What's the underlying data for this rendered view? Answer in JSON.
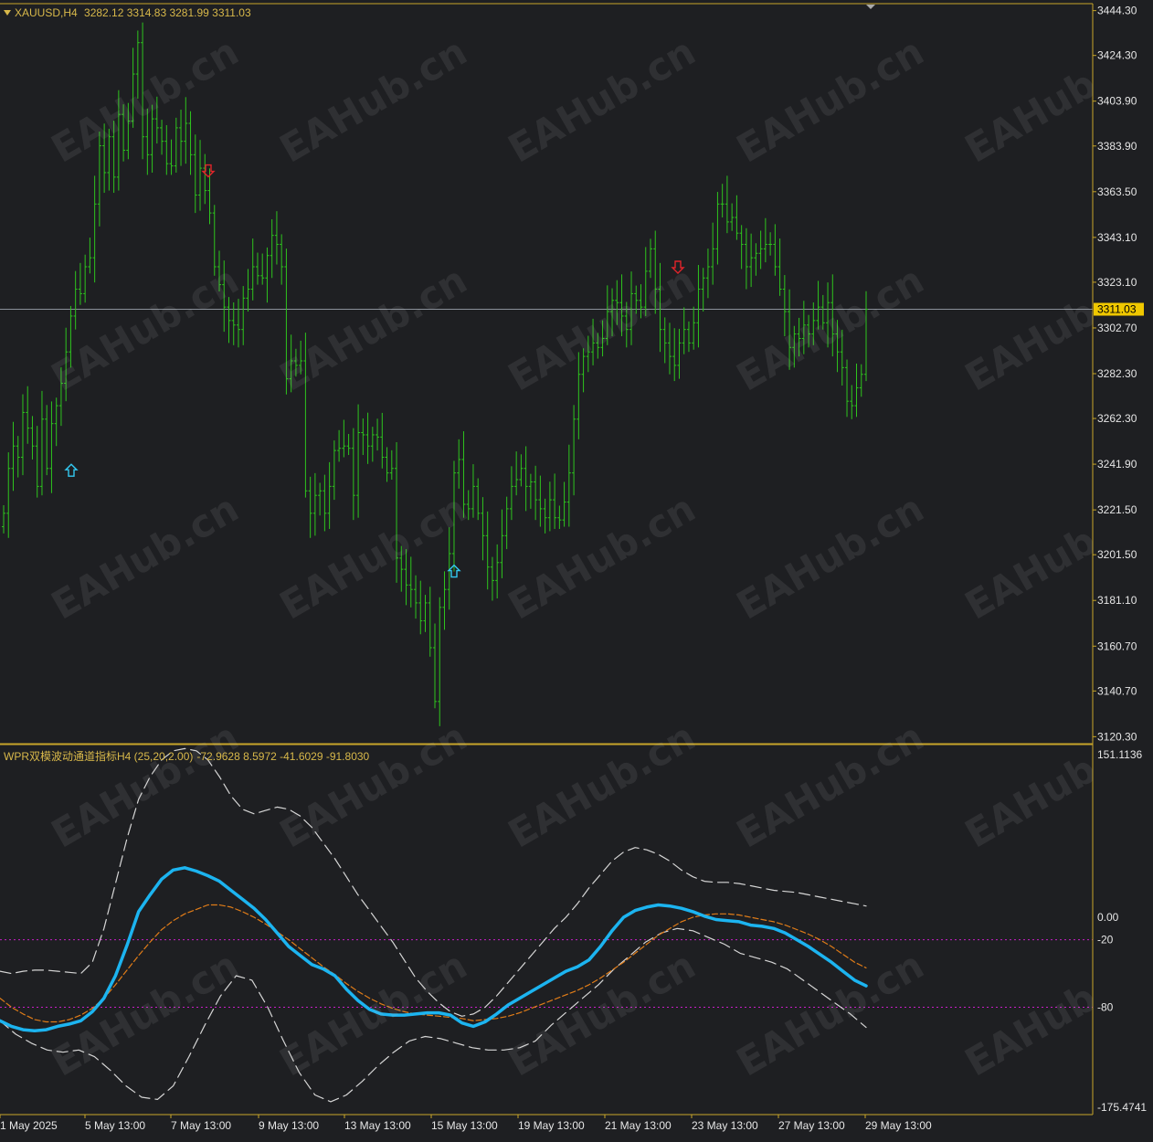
{
  "header": {
    "symbol": "XAUUSD,H4",
    "ohlc": "3282.12 3314.83 3281.99 3311.03"
  },
  "indicator": {
    "title": "WPR双模波动通道指标H4 (25,20,2.00)",
    "values": "-72.9628 8.5972 -41.6029 -91.8030",
    "levels": [
      -20,
      -80
    ],
    "top_label": "151.1136",
    "bottom_label": "-175.4741"
  },
  "watermark": "EAHub.cn",
  "colors": {
    "background": "#1e1f22",
    "frame": "#c8a62a",
    "bar": "#2ec41e",
    "price_line": "#8a9099",
    "price_tag": "#f0c800",
    "arrow_up": "#33c8f0",
    "arrow_down": "#e0242a",
    "wpr_main": "#1cb4f0",
    "wpr_signal": "#e07c18",
    "band": "#d6d6d6",
    "level": "#c81ec8",
    "axis_text": "#e6e6e6"
  },
  "chart_data": {
    "type": "ohlc",
    "price_ticks": [
      "3444.30",
      "3424.30",
      "3403.90",
      "3383.90",
      "3363.50",
      "3343.10",
      "3323.10",
      "3302.70",
      "3282.30",
      "3262.30",
      "3241.90",
      "3221.50",
      "3201.50",
      "3181.10",
      "3160.70",
      "3140.70",
      "3120.30"
    ],
    "current_price": "3311.03",
    "indicator_ticks": [
      "0.00",
      "-20",
      "-80"
    ],
    "time_labels": [
      "1 May 2025",
      "5 May 13:00",
      "7 May 13:00",
      "9 May 13:00",
      "13 May 13:00",
      "15 May 13:00",
      "19 May 13:00",
      "21 May 13:00",
      "23 May 13:00",
      "27 May 13:00",
      "29 May 13:00"
    ],
    "price_ylim": [
      3118,
      3447
    ],
    "wpr_ylim": [
      -175.4741,
      151.1136
    ],
    "price_series": [
      3220,
      3240,
      3250,
      3245,
      3265,
      3258,
      3250,
      3232,
      3262,
      3240,
      3260,
      3268,
      3278,
      3292,
      3308,
      3320,
      3318,
      3330,
      3334,
      3358,
      3384,
      3372,
      3388,
      3370,
      3398,
      3382,
      3395,
      3416,
      3430,
      3388,
      3380,
      3396,
      3392,
      3386,
      3376,
      3375,
      3392,
      3386,
      3394,
      3380,
      3362,
      3374,
      3364,
      3354,
      3330,
      3322,
      3312,
      3306,
      3304,
      3302,
      3316,
      3320,
      3330,
      3326,
      3325,
      3335,
      3344,
      3340,
      3330,
      3280,
      3288,
      3286,
      3288,
      3230,
      3220,
      3228,
      3230,
      3220,
      3232,
      3248,
      3249,
      3250,
      3249,
      3228,
      3256,
      3255,
      3250,
      3255,
      3254,
      3245,
      3238,
      3240,
      3200,
      3195,
      3188,
      3186,
      3180,
      3172,
      3180,
      3160,
      3136,
      3178,
      3186,
      3202,
      3238,
      3244,
      3224,
      3222,
      3232,
      3220,
      3210,
      3196,
      3190,
      3198,
      3210,
      3222,
      3232,
      3235,
      3240,
      3232,
      3234,
      3226,
      3222,
      3218,
      3226,
      3218,
      3217,
      3225,
      3238,
      3262,
      3282,
      3290,
      3292,
      3296,
      3294,
      3298,
      3310,
      3315,
      3314,
      3308,
      3302,
      3318,
      3315,
      3312,
      3328,
      3338,
      3320,
      3302,
      3296,
      3290,
      3286,
      3296,
      3302,
      3296,
      3305,
      3320,
      3325,
      3330,
      3338,
      3358,
      3358,
      3350,
      3352,
      3345,
      3340,
      3330,
      3334,
      3336,
      3338,
      3340,
      3340,
      3330,
      3320,
      3310,
      3294,
      3300,
      3298,
      3304,
      3300,
      3306,
      3312,
      3305,
      3314,
      3300,
      3292,
      3285,
      3270,
      3268,
      3276,
      3282,
      3311
    ],
    "wpr_main": [
      -92,
      -97,
      -100,
      -101,
      -100,
      -97,
      -95,
      -92,
      -84,
      -72,
      -52,
      -25,
      5,
      20,
      34,
      42,
      44,
      41,
      37,
      32,
      24,
      16,
      8,
      -2,
      -14,
      -26,
      -34,
      -42,
      -46,
      -52,
      -64,
      -74,
      -82,
      -86,
      -87,
      -87,
      -86,
      -85,
      -85,
      -87,
      -94,
      -97,
      -93,
      -86,
      -78,
      -72,
      -66,
      -60,
      -54,
      -48,
      -44,
      -38,
      -26,
      -12,
      0,
      6,
      9,
      11,
      10,
      8,
      5,
      1,
      -2,
      -3,
      -4,
      -7,
      -8,
      -10,
      -14,
      -20,
      -26,
      -33,
      -40,
      -48,
      -56,
      -61
    ],
    "wpr_signal": [
      -72,
      -80,
      -86,
      -91,
      -93,
      -93,
      -91,
      -87,
      -81,
      -72,
      -60,
      -47,
      -34,
      -22,
      -11,
      -3,
      3,
      7,
      11,
      11,
      9,
      5,
      0,
      -6,
      -13,
      -20,
      -28,
      -36,
      -44,
      -51,
      -59,
      -66,
      -72,
      -77,
      -81,
      -84,
      -86,
      -87,
      -88,
      -89,
      -90,
      -92,
      -91,
      -90,
      -88,
      -85,
      -81,
      -77,
      -73,
      -69,
      -65,
      -60,
      -54,
      -47,
      -40,
      -32,
      -24,
      -16,
      -10,
      -4,
      0,
      2,
      3,
      3,
      2,
      0,
      -2,
      -4,
      -7,
      -11,
      -15,
      -20,
      -26,
      -33,
      -40,
      -45
    ],
    "wpr_upper": [
      -48,
      -50,
      -48,
      -47,
      -47,
      -48,
      -49,
      -50,
      -40,
      -10,
      30,
      70,
      105,
      125,
      140,
      148,
      150,
      148,
      140,
      125,
      108,
      96,
      92,
      95,
      98,
      96,
      90,
      80,
      66,
      52,
      36,
      20,
      6,
      -8,
      -22,
      -38,
      -54,
      -66,
      -76,
      -84,
      -88,
      -86,
      -80,
      -70,
      -58,
      -46,
      -34,
      -22,
      -10,
      0,
      12,
      26,
      38,
      50,
      58,
      62,
      60,
      56,
      50,
      42,
      36,
      32,
      31,
      31,
      30,
      28,
      26,
      24,
      23,
      22,
      20,
      18,
      16,
      14,
      12,
      10
    ],
    "wpr_lower": [
      -92,
      -104,
      -112,
      -118,
      -120,
      -118,
      -124,
      -136,
      -150,
      -160,
      -162,
      -150,
      -124,
      -96,
      -70,
      -52,
      -56,
      -80,
      -110,
      -138,
      -158,
      -164,
      -158,
      -146,
      -132,
      -120,
      -110,
      -106,
      -108,
      -112,
      -116,
      -118,
      -118,
      -116,
      -110,
      -96,
      -84,
      -72,
      -60,
      -46,
      -34,
      -22,
      -14,
      -10,
      -12,
      -18,
      -24,
      -32,
      -36,
      -40,
      -46,
      -56,
      -66,
      -76,
      -86,
      -98
    ]
  }
}
